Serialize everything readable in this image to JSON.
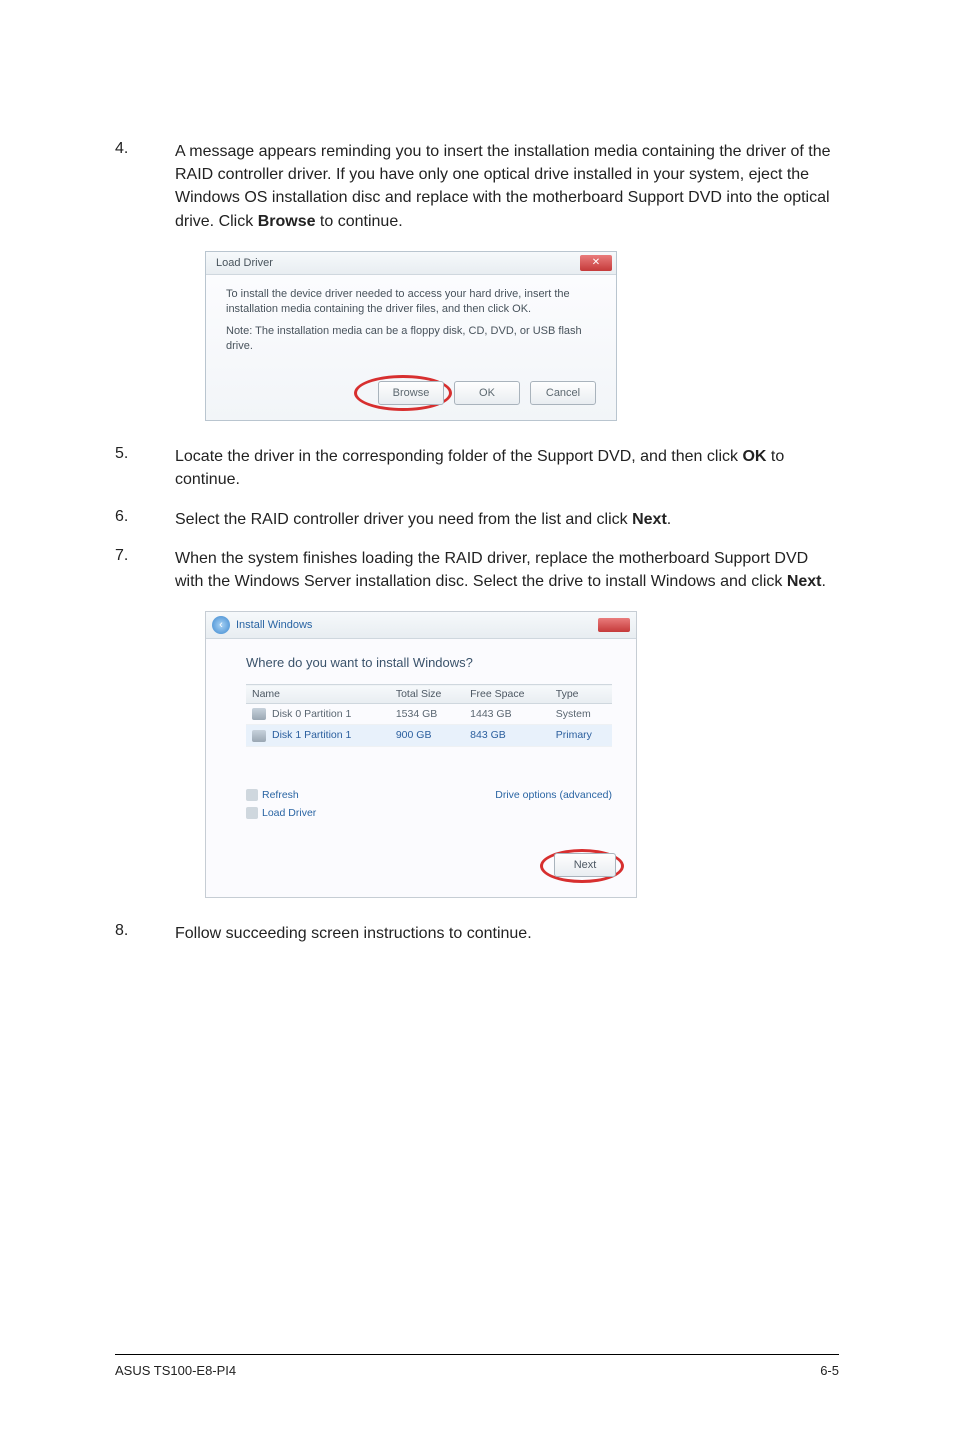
{
  "steps": {
    "s4": {
      "num": "4.",
      "text_a": "A message appears reminding you to insert the installation media containing the driver of the RAID controller driver. If you have only one optical drive installed in your system, eject the Windows OS installation disc and replace with the motherboard Support DVD into the optical drive. Click ",
      "bold_a": "Browse",
      "text_b": " to continue."
    },
    "s5": {
      "num": "5.",
      "text_a": "Locate the driver in the corresponding folder of the Support DVD, and then click ",
      "bold_a": "OK",
      "text_b": " to continue."
    },
    "s6": {
      "num": "6.",
      "text_a": "Select the RAID controller driver you need from the list and click ",
      "bold_a": "Next",
      "text_b": "."
    },
    "s7": {
      "num": "7.",
      "text_a": "When the system finishes loading the RAID driver, replace the motherboard Support DVD with the Windows Server installation disc. Select the drive to install Windows and click ",
      "bold_a": "Next",
      "text_b": "."
    },
    "s8": {
      "num": "8.",
      "text_a": "Follow succeeding screen instructions to continue."
    }
  },
  "dialog1": {
    "title": "Load Driver",
    "msg": "To install the device driver needed to access your hard drive, insert the installation media containing the driver files, and then click OK.",
    "note": "Note: The installation media can be a floppy disk, CD, DVD, or USB flash drive.",
    "buttons": {
      "browse": "Browse",
      "ok": "OK",
      "cancel": "Cancel"
    }
  },
  "dialog2": {
    "title": "Install Windows",
    "heading": "Where do you want to install Windows?",
    "columns": {
      "name": "Name",
      "total": "Total Size",
      "free": "Free Space",
      "type": "Type"
    },
    "rows": [
      {
        "name": "Disk 0 Partition 1",
        "total": "1534 GB",
        "free": "1443 GB",
        "type": "System"
      },
      {
        "name": "Disk 1 Partition 1",
        "total": "900 GB",
        "free": "843 GB",
        "type": "Primary"
      }
    ],
    "links": {
      "refresh": "Refresh",
      "load": "Load Driver",
      "adv": "Drive options (advanced)"
    },
    "next": "Next"
  },
  "footer": {
    "left": "ASUS TS100-E8-PI4",
    "right": "6-5"
  }
}
